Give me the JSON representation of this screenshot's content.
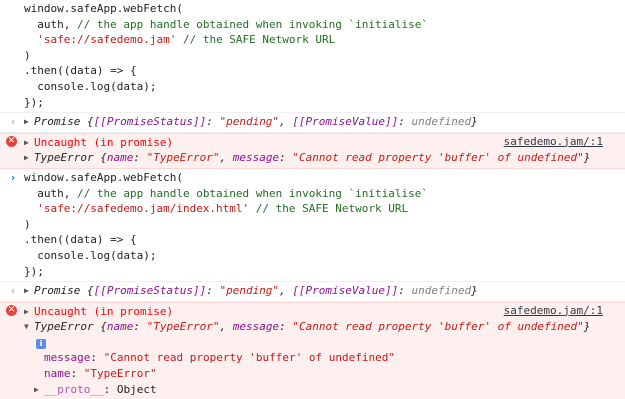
{
  "entries": [
    {
      "type": "input",
      "lines": [
        "window.safeApp.webFetch(",
        "  auth, ",
        "  ",
        ")",
        ".then((data) => {",
        "  console.log(data);",
        "});"
      ],
      "comment1": "// the app handle obtained when invoking `initialise`",
      "url_string": "'safe://safedemo.jam'",
      "comment2": " // the SAFE Network URL"
    },
    {
      "type": "result",
      "label": "Promise",
      "status_key": "[[PromiseStatus]]",
      "status_val": "\"pending\"",
      "value_key": "[[PromiseValue]]",
      "value_val": "undefined"
    },
    {
      "type": "error",
      "message": "Uncaught (in promise)",
      "source": "safedemo.jam/:1",
      "detail_label": "TypeError",
      "name_key": "name",
      "name_val": "\"TypeError\"",
      "message_key": "message",
      "message_val": "\"Cannot read property 'buffer' of undefined\""
    },
    {
      "type": "input",
      "lines": [
        "window.safeApp.webFetch(",
        "  auth, ",
        "  ",
        ")",
        ".then((data) => {",
        "  console.log(data);",
        "});"
      ],
      "comment1": "// the app handle obtained when invoking `initialise`",
      "url_string": "'safe://safedemo.jam/index.html'",
      "comment2": " // the SAFE Network URL"
    },
    {
      "type": "result",
      "label": "Promise",
      "status_key": "[[PromiseStatus]]",
      "status_val": "\"pending\"",
      "value_key": "[[PromiseValue]]",
      "value_val": "undefined"
    },
    {
      "type": "error",
      "message": "Uncaught (in promise)",
      "source": "safedemo.jam/:1",
      "detail_label": "TypeError",
      "name_key": "name",
      "name_val": "\"TypeError\"",
      "message_key": "message",
      "message_val": "\"Cannot read property 'buffer' of undefined\"",
      "expanded": {
        "message_key": "message",
        "message_val": "\"Cannot read property 'buffer' of undefined\"",
        "name_key": "name",
        "name_val": "\"TypeError\"",
        "proto_key": "__proto__",
        "proto_val": "Object"
      }
    }
  ],
  "icons": {
    "prompt": "chevron-right-icon",
    "result": "chevron-left-icon",
    "error": "error-circle-icon",
    "expand": "triangle-right-icon",
    "collapse": "triangle-down-icon",
    "info": "info-icon"
  },
  "colors": {
    "error_bg": "#fff0f0",
    "error_text": "#ff0000",
    "comment": "#236e25",
    "string": "#c41a16",
    "property": "#881391"
  }
}
